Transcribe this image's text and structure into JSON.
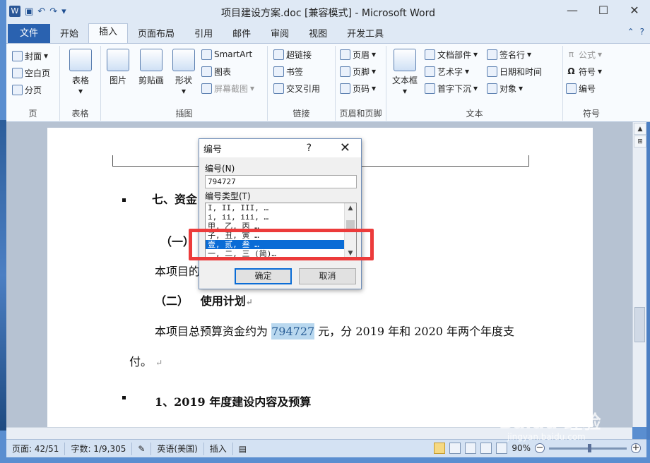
{
  "titlebar": {
    "title": "项目建设方案.doc [兼容模式] - Microsoft Word",
    "word_icon": "W"
  },
  "tabs": [
    "文件",
    "开始",
    "插入",
    "页面布局",
    "引用",
    "邮件",
    "审阅",
    "视图",
    "开发工具"
  ],
  "ribbon": {
    "page": {
      "items": [
        "封面",
        "空白页",
        "分页"
      ],
      "label": "页"
    },
    "table": {
      "button": "表格",
      "label": "表格"
    },
    "illustrations": {
      "buttons": [
        "图片",
        "剪贴画",
        "形状"
      ],
      "small": [
        "SmartArt",
        "图表",
        "屏幕截图"
      ],
      "label": "插图"
    },
    "links": {
      "items": [
        "超链接",
        "书签",
        "交叉引用"
      ],
      "label": "链接"
    },
    "headerfooter": {
      "items": [
        "页眉",
        "页脚",
        "页码"
      ],
      "label": "页眉和页脚"
    },
    "text": {
      "button": "文本框",
      "col1": [
        "文档部件",
        "艺术字",
        "首字下沉"
      ],
      "col2": [
        "签名行",
        "日期和时间",
        "对象"
      ],
      "label": "文本"
    },
    "symbols": {
      "items": [
        "公式",
        "符号",
        "编号"
      ],
      "label": "符号"
    }
  },
  "document": {
    "heading7": "七、资金",
    "sub1": "（一）",
    "para1": "本项目的",
    "sub2_num": "（二）",
    "sub2_text": "使用计划",
    "para2_pre": "本项目总预算资金约为 ",
    "para2_hl": "794727",
    "para2_post": " 元，分 2019 年和 2020 年两个年度支",
    "para2_cont": "付。",
    "heading_1": "1、2019 年度建设内容及预算"
  },
  "dialog": {
    "title": "编号",
    "help": "?",
    "number_label": "编号(N)",
    "number_value": "794727",
    "type_label": "编号类型(T)",
    "types": [
      "I, II, III, …",
      "i, ii, iii, …",
      "甲, 乙, 丙 …",
      "子, 丑, 寅 …",
      "壹, 贰, 叁 …",
      "一, 二, 三 (简)…"
    ],
    "selected_type": "壹, 贰, 叁 …",
    "ok": "确定",
    "cancel": "取消"
  },
  "status": {
    "page": "页面: 42/51",
    "words": "字数: 1/9,305",
    "lang": "英语(美国)",
    "mode": "插入",
    "zoom": "90%"
  },
  "watermark": {
    "logo": "Baidu 经验",
    "url": "jingyan.baidu.com"
  }
}
